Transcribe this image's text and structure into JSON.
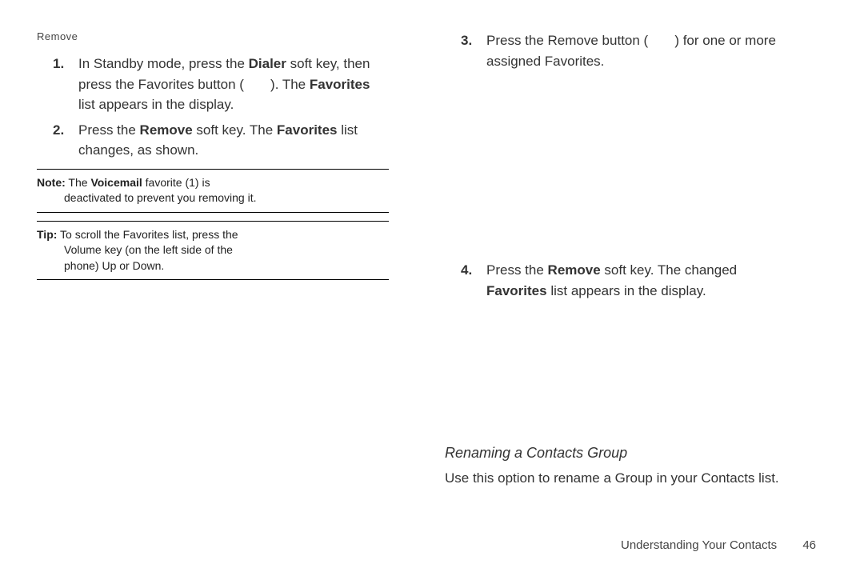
{
  "header_small": "Remove",
  "left": {
    "step1": {
      "num": "1.",
      "pre": "In Standby mode, press the ",
      "b1": "Dialer",
      "mid1": " soft key, then press the Favorites button (",
      "mid2": "). The ",
      "b2": "Favorites",
      "post": " list appears in the display."
    },
    "step2": {
      "num": "2.",
      "pre": "Press the ",
      "b1": "Remove",
      "mid": " soft key. The ",
      "b2": "Favorites",
      "post": " list changes, as shown."
    },
    "note": {
      "label": "Note:",
      "line1": " The ",
      "b1": "Voicemail",
      "line1b": " favorite (1) is",
      "line2": "deactivated to prevent you removing it."
    },
    "tip": {
      "label": "Tip:",
      "line1": " To scroll the Favorites list, press the",
      "line2": "Volume key (on the left side of the",
      "line3": "phone) Up or Down."
    }
  },
  "right": {
    "step3": {
      "num": "3.",
      "pre": "Press the Remove button (",
      "post": ") for one or more assigned Favorites."
    },
    "step4": {
      "num": "4.",
      "pre": "Press the ",
      "b1": "Remove",
      "mid": " soft key. The changed ",
      "b2": "Favorites",
      "post": " list appears in the display."
    },
    "subhead": "Renaming a Contacts Group",
    "subdesc": "Use this option to rename a Group in your Contacts list."
  },
  "footer": {
    "section": "Understanding Your Contacts",
    "page": "46"
  }
}
